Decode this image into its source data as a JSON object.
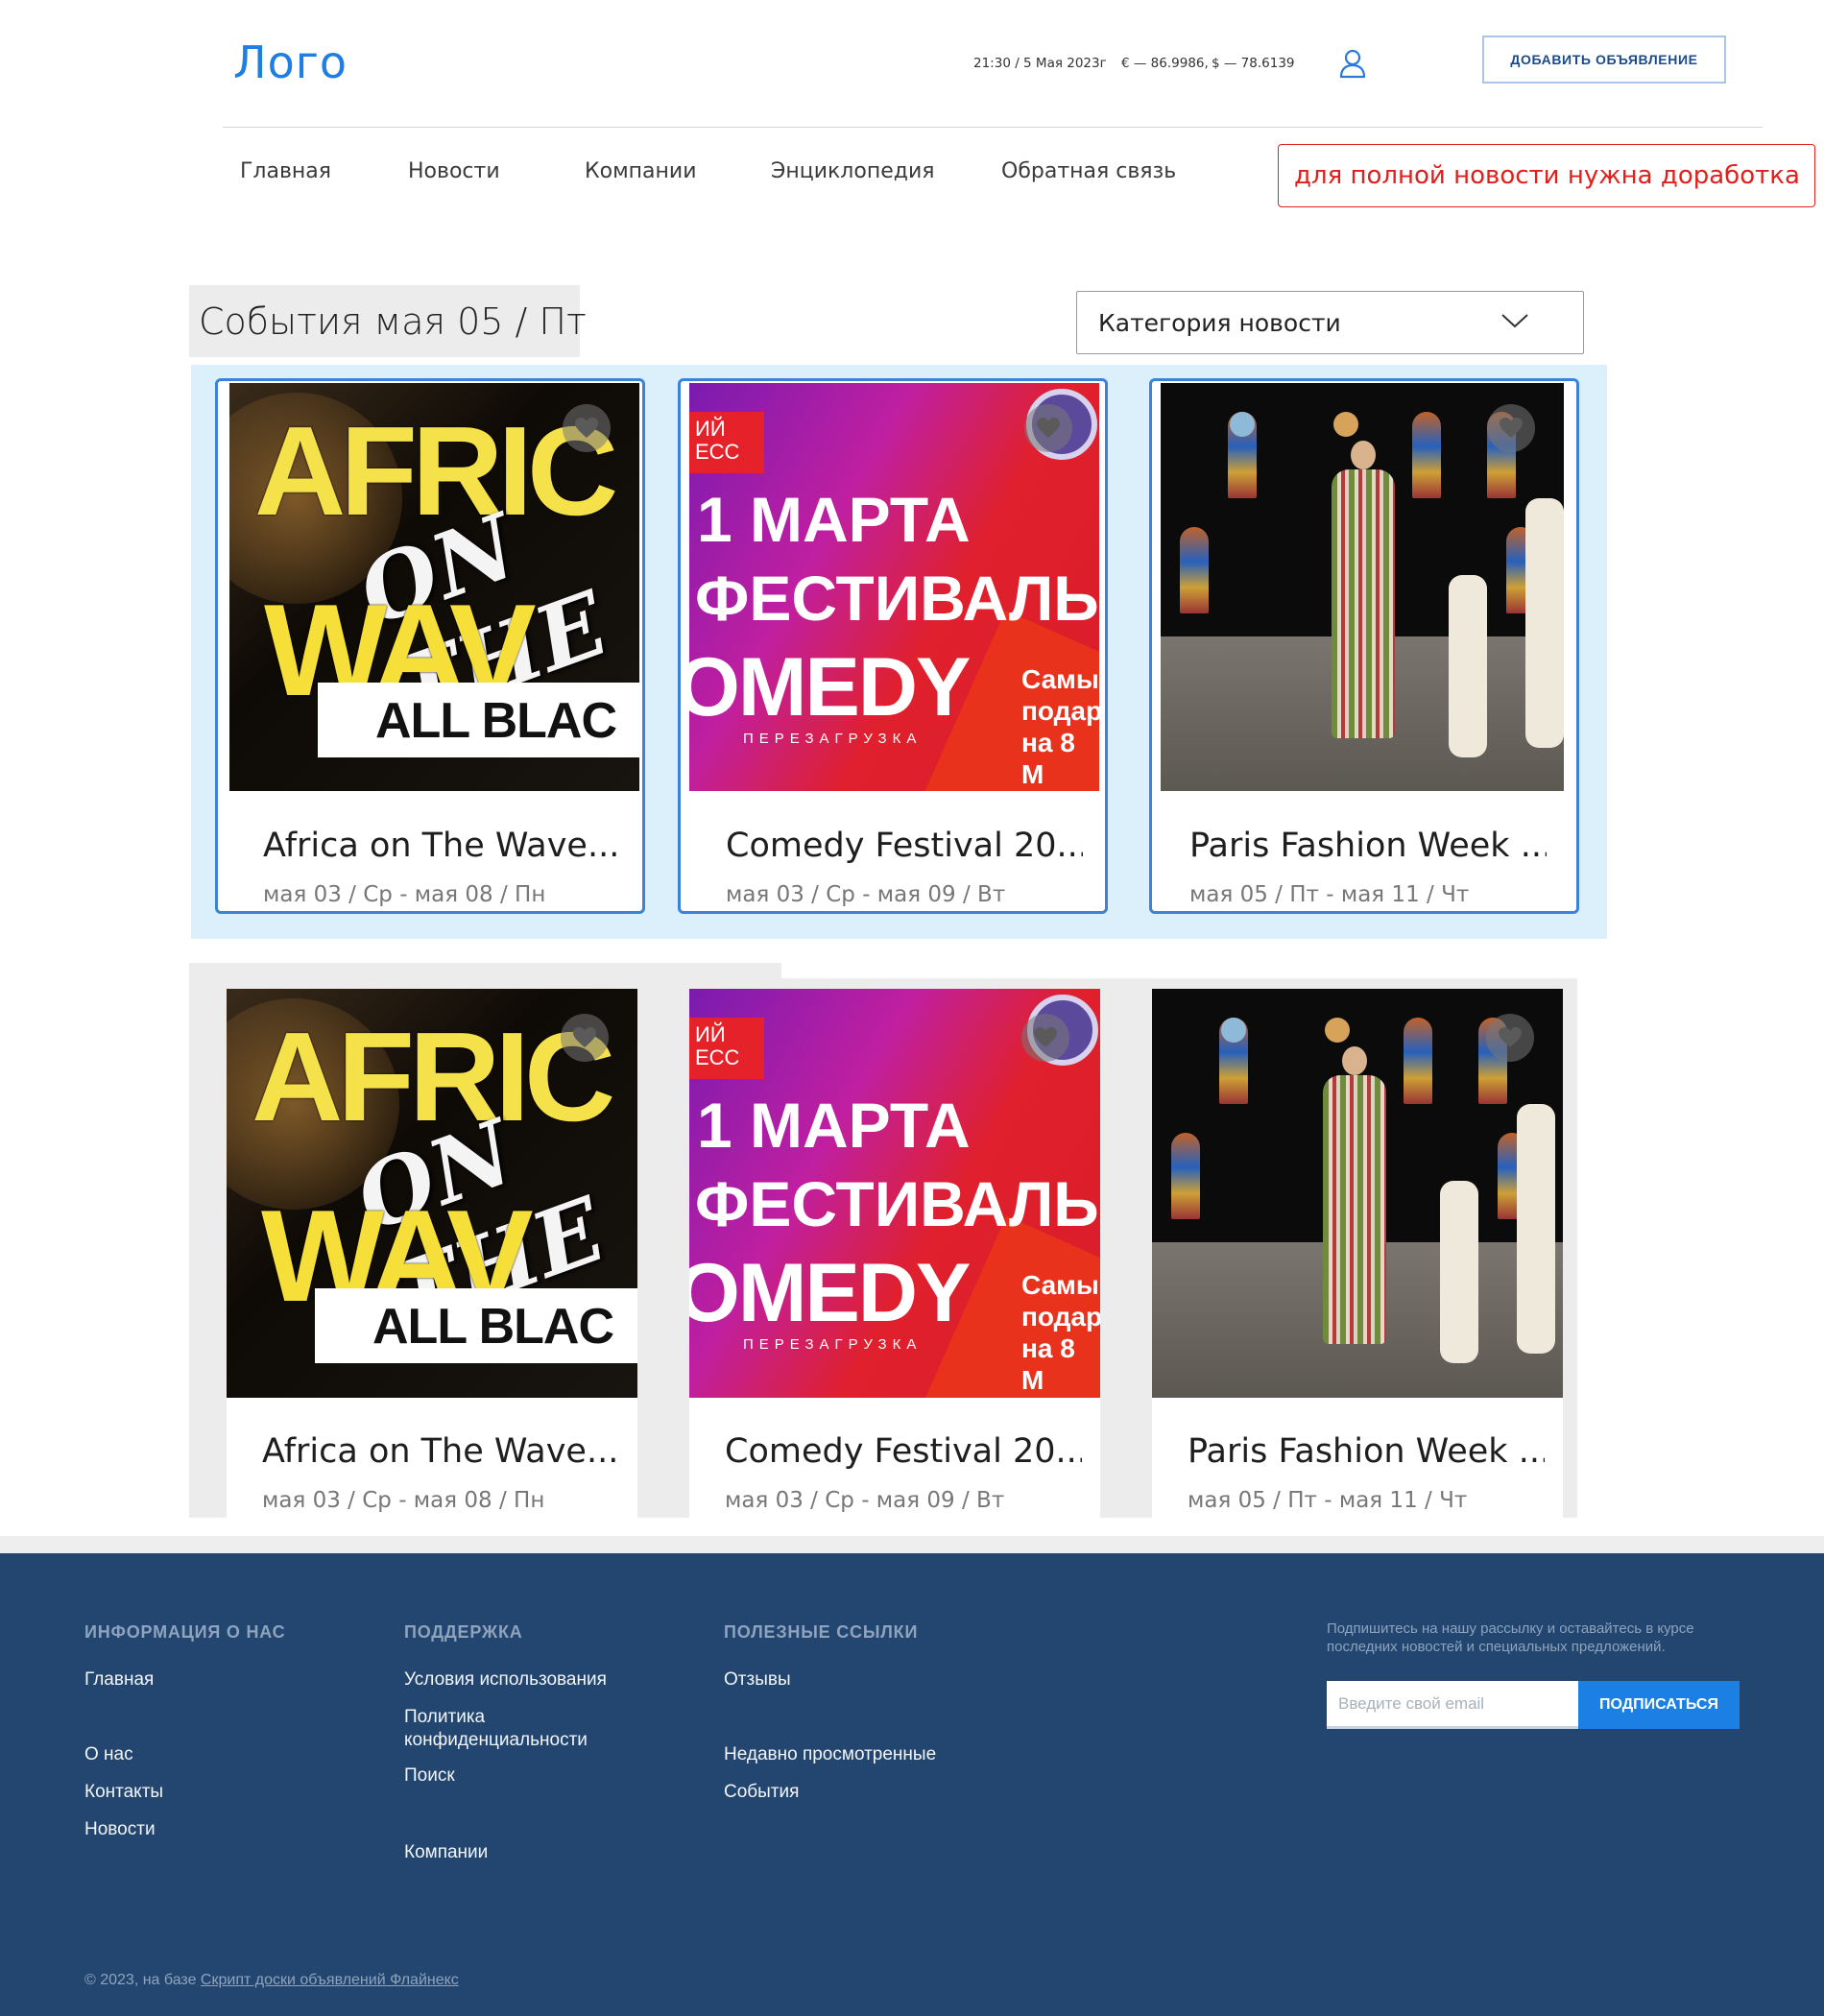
{
  "header": {
    "logo": "Лого",
    "time": "21:30 / 5 Мая 2023г",
    "eur": "€ — 86.9986,",
    "usd": "$ — 78.6139",
    "add_button": "ДОБАВИТЬ ОБЪЯВЛЕНИЕ"
  },
  "nav": {
    "items": [
      "Главная",
      "Новости",
      "Компании",
      "Энциклопедия",
      "Обратная связь"
    ]
  },
  "note": "для полной новости нужна доработка",
  "section": {
    "title": "События мая 05 / Пт",
    "category_label": "Категория новости"
  },
  "cards": [
    {
      "title": "Africa on The Wave...",
      "date": "мая 03 / Ср - мая 08 / Пн",
      "image": "africa-on-the-wave-poster"
    },
    {
      "title": "Comedy Festival 20...",
      "date": "мая 03 / Ср - мая 09 / Вт",
      "image": "comedy-festival-poster"
    },
    {
      "title": "Paris Fashion Week ...",
      "date": "мая 05 / Пт - мая 11 / Чт",
      "image": "paris-fashion-week-photo"
    }
  ],
  "posters": {
    "africa": {
      "line1": "AFRIC",
      "line2": "ON THE",
      "line3": "WAV",
      "line4": "ALL BLAC"
    },
    "comedy": {
      "tag": "ИЙ\nЕСС",
      "line1": "1 МАРТА",
      "line2": "ФЕСТИВАЛЬ",
      "line3": "OMEDY",
      "line4": "ПЕРЕЗАГРУЗКА",
      "line5": "Самы\nподар\nна 8 М"
    }
  },
  "footer": {
    "col1": {
      "heading": "ИНФОРМАЦИЯ О НАС",
      "links": [
        "Главная",
        "О нас",
        "Контакты",
        "Новости"
      ]
    },
    "col2": {
      "heading": "ПОДДЕРЖКА",
      "links": [
        "Условия использования",
        "Политика конфиденциальности",
        "Поиск",
        "Компании"
      ]
    },
    "col3": {
      "heading": "ПОЛЕЗНЫЕ ССЫЛКИ",
      "links": [
        "Отзывы",
        "Недавно просмотренные",
        "События"
      ]
    },
    "subscribe_text": "Подпишитесь на нашу рассылку и оставайтесь в курсе последних новостей и специальных предложений.",
    "email_placeholder": "Введите свой email",
    "subscribe_button": "ПОДПИСАТЬСЯ",
    "copyright": "© 2023, на базе",
    "copyright_link": "Скрипт доски объявлений Флайнекс"
  },
  "colors": {
    "accent": "#1f7ee0",
    "footer_bg": "#234670",
    "card_outline": "#3d81db",
    "highlight_bg": "#dcf0fc",
    "note_red": "#e0201c"
  },
  "icons": [
    "user-icon",
    "chevron-down-icon",
    "heart-icon"
  ]
}
